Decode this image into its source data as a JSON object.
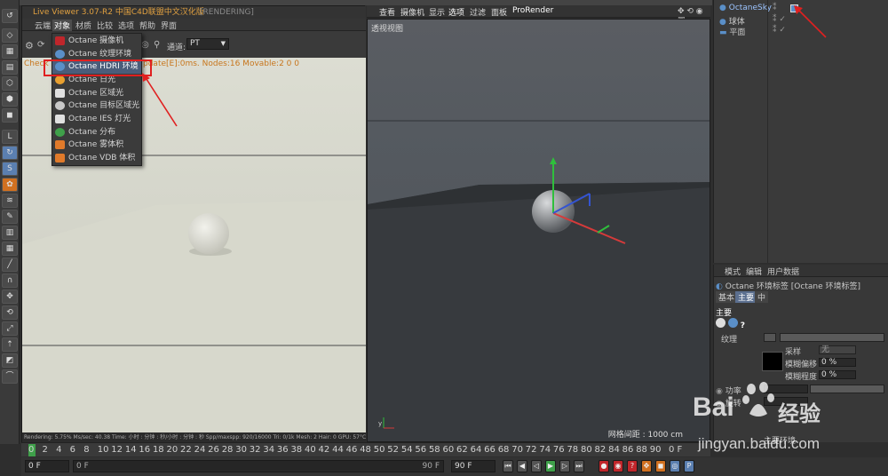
{
  "live_viewer": {
    "title": "Live Viewer 3.07-R2 中国C4D联盟中文汉化版",
    "status_tag": "[RENDERING]",
    "menu": [
      "云端",
      "对象",
      "材质",
      "比较",
      "选项",
      "帮助",
      "界面"
    ],
    "active_menu": "对象",
    "channel_label": "通道:",
    "channel_value": "PT",
    "check_text": "Check",
    "update_text": "pdate[E]:0ms. Nodes:16 Movable:2  0 0",
    "status_bar": "Rendering: 5.75%   Ms/sec: 40.38   Time: 小时 : 分钟 : 秒/小时 : 分钟 : 秒   Spp/maxspp: 920/16000   Tri: 0/1k   Mesh: 2   Hair: 0   GPU: 57°C"
  },
  "dropdown": {
    "items": [
      {
        "label": "Octane 摄像机",
        "icon": "camera-icon",
        "color": "#c0262b"
      },
      {
        "label": "Octane 纹理环境",
        "icon": "texture-environment-icon",
        "color": "#5a8fc8"
      },
      {
        "label": "Octane HDRI 环境",
        "icon": "hdri-environment-icon",
        "color": "#5a8fc8",
        "highlighted": true
      },
      {
        "label": "Octane 日光",
        "icon": "sun-icon",
        "color": "#e8a030"
      },
      {
        "label": "Octane 区域光",
        "icon": "area-light-icon",
        "color": "#e0e0e0"
      },
      {
        "label": "Octane 目标区域光",
        "icon": "target-area-light-icon",
        "color": "#c8c8c8"
      },
      {
        "label": "Octane IES 灯光",
        "icon": "ies-light-icon",
        "color": "#e0e0e0"
      },
      {
        "label": "Octane 分布",
        "icon": "scatter-icon",
        "color": "#3fa04a"
      },
      {
        "label": "Octane 雾体积",
        "icon": "fog-volume-icon",
        "color": "#e07a2a"
      },
      {
        "label": "Octane VDB 体积",
        "icon": "vdb-volume-icon",
        "color": "#e07a2a"
      }
    ]
  },
  "viewport": {
    "menu": [
      "查看",
      "摄像机",
      "显示",
      "选项",
      "过滤",
      "面板",
      "ProRender"
    ],
    "active_menu": "选项",
    "label": "透视视图",
    "grid_text": "网格间距 : 1000 cm"
  },
  "object_manager": {
    "objects": [
      {
        "name": "OctaneSky"
      },
      {
        "name": "球体"
      },
      {
        "name": "平面"
      }
    ]
  },
  "attributes": {
    "menu": [
      "模式",
      "编辑",
      "用户数据"
    ],
    "tag_title": "Octane 环境标签 [Octane 环境标签]",
    "tabs": [
      "基本",
      "主要",
      "中"
    ],
    "section": "主要",
    "texture_label": "纹理",
    "sample_label": "采样",
    "sample_value": "无",
    "offset_x_label": "模糊偏移",
    "offset_x_value": "0 %",
    "offset_y_label": "模糊程度",
    "offset_y_value": "0 %",
    "power_label": "功率",
    "rotation_label": "旋转",
    "bottom_label": "主要环境"
  },
  "timeline": {
    "ticks": [
      "0",
      "2",
      "4",
      "6",
      "8",
      "10",
      "12",
      "14",
      "16",
      "18",
      "20",
      "22",
      "24",
      "26",
      "28",
      "30",
      "32",
      "34",
      "36",
      "38",
      "40",
      "42",
      "44",
      "46",
      "48",
      "50",
      "52",
      "54",
      "56",
      "58",
      "60",
      "62",
      "64",
      "66",
      "68",
      "70",
      "72",
      "74",
      "76",
      "78",
      "80",
      "82",
      "84",
      "86",
      "88",
      "90"
    ],
    "end_label": "0 F",
    "start_field": "0 F",
    "range_start": "0 F",
    "range_end": "90 F",
    "end_field": "90 F"
  },
  "watermark": {
    "brand": "Bai",
    "brand2": "经验",
    "url": "jingyan.baidu.com"
  },
  "colors": {
    "accent_red": "#e02020",
    "title_orange": "#e0a040",
    "highlight_blue": "#4a5d7a"
  }
}
